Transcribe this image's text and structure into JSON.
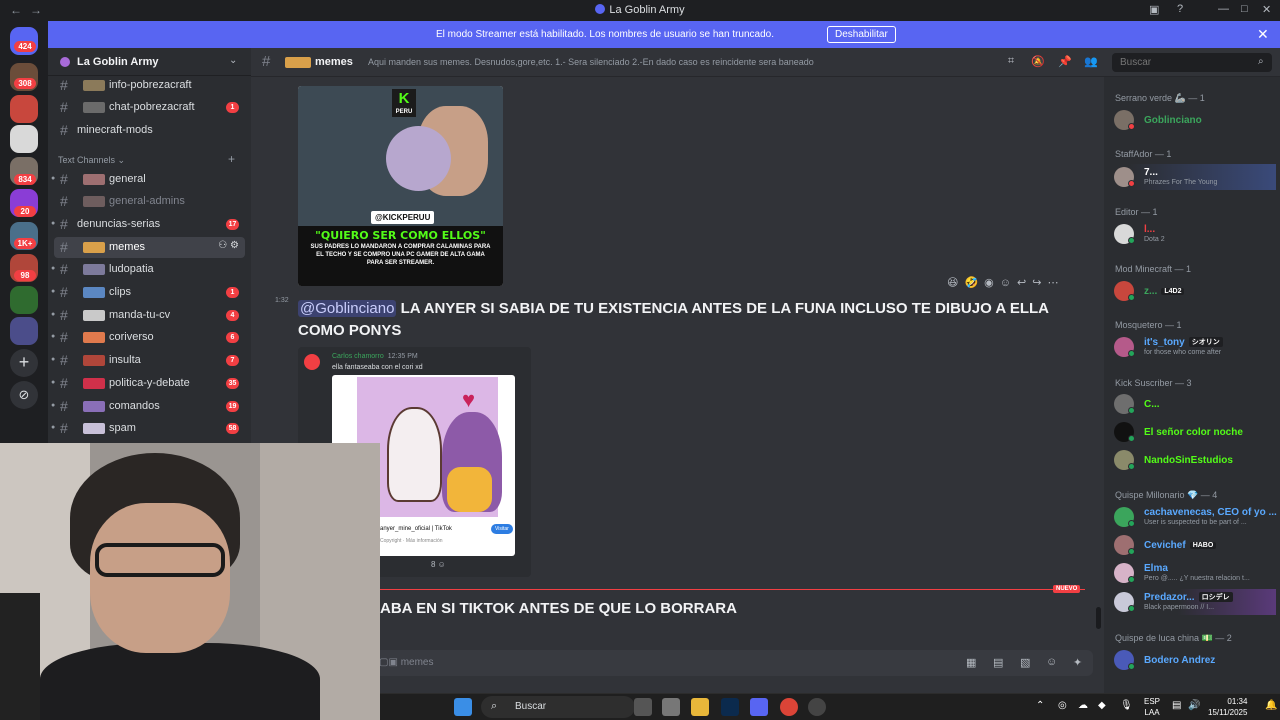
{
  "window": {
    "title": "La Goblin Army"
  },
  "rail": {
    "badges": [
      "424",
      "308",
      "834",
      "20",
      "1K+",
      "98"
    ]
  },
  "banner": {
    "message": "El modo Streamer está habilitado. Los nombres de usuario se han truncado.",
    "button": "Deshabilitar"
  },
  "guild": {
    "name": "La Goblin Army"
  },
  "channels": {
    "top": [
      {
        "label": "info-pobrezacraft",
        "count": ""
      },
      {
        "label": "chat-pobrezacraft",
        "count": "1"
      },
      {
        "label": "minecraft-mods",
        "count": ""
      }
    ],
    "category": "Text Channels",
    "list": [
      {
        "label": "general",
        "count": ""
      },
      {
        "label": "general-admins",
        "count": ""
      },
      {
        "label": "denuncias-serias",
        "count": "17"
      },
      {
        "label": "memes",
        "count": ""
      },
      {
        "label": "ludopatia",
        "count": ""
      },
      {
        "label": "clips",
        "count": "1"
      },
      {
        "label": "manda-tu-cv",
        "count": "4"
      },
      {
        "label": "coriverso",
        "count": "6"
      },
      {
        "label": "insulta",
        "count": "7"
      },
      {
        "label": "politica-y-debate",
        "count": "35"
      },
      {
        "label": "comandos",
        "count": "19"
      },
      {
        "label": "spam",
        "count": "58"
      }
    ]
  },
  "chat": {
    "channel_name": "memes",
    "topic": "Aqui manden sus memes. Desnudos,gore,etc. 1.- Sera silenciado 2.-En dado caso es reincidente sera baneado",
    "search_placeholder": "Buscar",
    "thumbnail": {
      "k_letter": "K",
      "k_brand": "PERU",
      "handle": "@KICKPERUU",
      "headline": "\"QUIERO SER COMO ELLOS\"",
      "subline": "SUS PADRES LO MANDARON A COMPRAR CALAMINAS PARA EL TECHO Y SE COMPRO UNA PC GAMER DE ALTA GAMA PARA SER STREAMER."
    },
    "message": {
      "time": "1:32",
      "mention": "@Goblinciano",
      "text": "LA ANYER SI SABIA DE TU EXISTENCIA ANTES DE LA FUNA INCLUSO TE DIBUJO A ELLA COMO PONYS"
    },
    "embed": {
      "author": "Carlos chamorro",
      "time": "12:35 PM",
      "quote": "ella fantaseaba con el cori xd",
      "card_title": "anyer_mine_oficial | TikTok",
      "card_sub": "Copyright · Más información",
      "visit": "Visitar",
      "reaction_count": "8"
    },
    "new_marker": "NUEVO",
    "message2": "ABA EN SI TIKTOK ANTES DE QUE LO BORRARA",
    "composer_placeholder": "memes"
  },
  "members": {
    "groups": [
      {
        "role": "Serrano verde 🦾 — 1",
        "users": [
          {
            "name": "Goblinciano",
            "status": "",
            "color": "#3ba55c"
          }
        ]
      },
      {
        "role": "StaffAdor — 1",
        "users": [
          {
            "name": "7...",
            "status": "Phrazes For The Young",
            "color": "#ffffff"
          }
        ]
      },
      {
        "role": "Editor — 1",
        "users": [
          {
            "name": "l...",
            "status": "Dota 2",
            "color": "#f23f43"
          }
        ]
      },
      {
        "role": "Mod Minecraft — 1",
        "users": [
          {
            "name": "z...",
            "status": "",
            "color": "#3ba55c",
            "tag": "L4D2"
          }
        ]
      },
      {
        "role": "Mosquetero — 1",
        "users": [
          {
            "name": "it's_tony",
            "status": "for those who come after",
            "color": "#5aa9ff",
            "tag": "シオリン"
          }
        ]
      },
      {
        "role": "Kick Suscriber — 3",
        "users": [
          {
            "name": "C...",
            "status": "",
            "color": "#53fc18"
          },
          {
            "name": "El señor color noche",
            "status": "",
            "color": "#53fc18"
          },
          {
            "name": "NandoSinEstudios",
            "status": "",
            "color": "#53fc18"
          }
        ]
      },
      {
        "role": "Quispe Millonario 💎 — 4",
        "users": [
          {
            "name": "cachavenecas, CEO of yo ...",
            "status": "User is suspected to be part of ...",
            "color": "#5aa9ff"
          },
          {
            "name": "Cevichef",
            "status": "",
            "color": "#5aa9ff",
            "tag": "HABO"
          },
          {
            "name": "Elma",
            "status": "Pero @..... ¿Y nuestra relacion t...",
            "color": "#5aa9ff"
          },
          {
            "name": "Predazor...",
            "status": "Black papermoon // I...",
            "color": "#5aa9ff",
            "tag": "ロシデレ"
          }
        ]
      },
      {
        "role": "Quispe de luca china 💵 — 2",
        "users": [
          {
            "name": "Bodero Andrez",
            "status": "",
            "color": "#5aa9ff"
          }
        ]
      }
    ]
  },
  "taskbar": {
    "search": "Buscar",
    "lang_top": "ESP",
    "lang_bottom": "LAA",
    "time": "01:34",
    "date": "15/11/2025"
  },
  "colors": {
    "accent": "#5865f2",
    "danger": "#f23f43",
    "online": "#23a55a",
    "kick_green": "#53fc18"
  }
}
